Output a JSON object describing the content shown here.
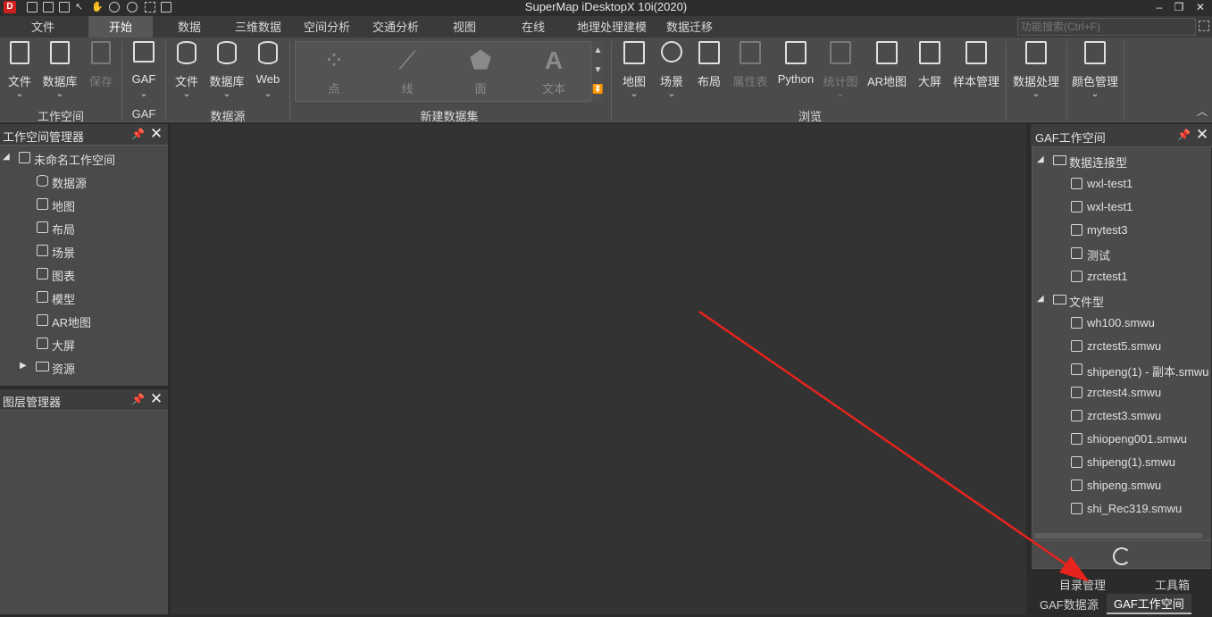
{
  "window": {
    "title": "SuperMap iDesktopX 10i(2020)",
    "logo": "D",
    "controls": [
      "–",
      "❐",
      "✕"
    ]
  },
  "menu": {
    "tabs": [
      "文件",
      "开始",
      "数据",
      "三维数据",
      "空间分析",
      "交通分析",
      "视图",
      "在线",
      "地理处理建模",
      "数据迁移"
    ],
    "active": "开始",
    "search_placeholder": "功能搜索(Ctrl+F)"
  },
  "ribbon": {
    "workspace": {
      "file": "文件",
      "database": "数据库",
      "save": "保存",
      "group": "工作空间"
    },
    "gaf": {
      "gaf": "GAF",
      "group": "GAF"
    },
    "datasource": {
      "file": "文件",
      "database": "数据库",
      "web": "Web",
      "group": "数据源"
    },
    "new_dataset": {
      "point": "点",
      "line": "线",
      "region": "面",
      "text": "文本",
      "group": "新建数据集",
      "text_glyph": "A"
    },
    "browse": {
      "map": "地图",
      "scene": "场景",
      "layout": "布局",
      "attribute_table": "属性表",
      "python": "Python",
      "stat_chart": "统计图",
      "ar_map": "AR地图",
      "big_screen": "大屏",
      "template": "样本管理",
      "group": "浏览"
    },
    "data_processing": "数据处理",
    "color_management": "颜色管理",
    "dropdown_glyph": "⌄"
  },
  "workspace_manager": {
    "title": "工作空间管理器",
    "root": "未命名工作空间",
    "items": [
      "数据源",
      "地图",
      "布局",
      "场景",
      "图表",
      "模型",
      "AR地图",
      "大屏",
      "资源"
    ]
  },
  "layer_manager": {
    "title": "图层管理器"
  },
  "gaf_workspace": {
    "title": "GAF工作空间",
    "connection_group": "数据连接型",
    "connection_items": [
      "wxl-test1",
      "wxl-test1",
      "mytest3",
      "测试",
      "zrctest1"
    ],
    "file_group": "文件型",
    "file_items": [
      "wh100.smwu",
      "zrctest5.smwu",
      "shipeng(1) - 副本.smwu",
      "zrctest4.smwu",
      "zrctest3.smwu",
      "shiopeng001.smwu",
      "shipeng(1).smwu",
      "shipeng.smwu",
      "shi_Rec319.smwu"
    ]
  },
  "bottom_tabs": {
    "row1": [
      "目录管理",
      "工具箱"
    ],
    "row2": [
      "GAF数据源",
      "GAF工作空间"
    ],
    "active": "GAF工作空间"
  },
  "colors": {
    "annotation_arrow": "#e8231d",
    "ribbon_bg": "#4b4b4b",
    "panel_bg": "#4a4a4a",
    "document_bg": "#333333"
  }
}
